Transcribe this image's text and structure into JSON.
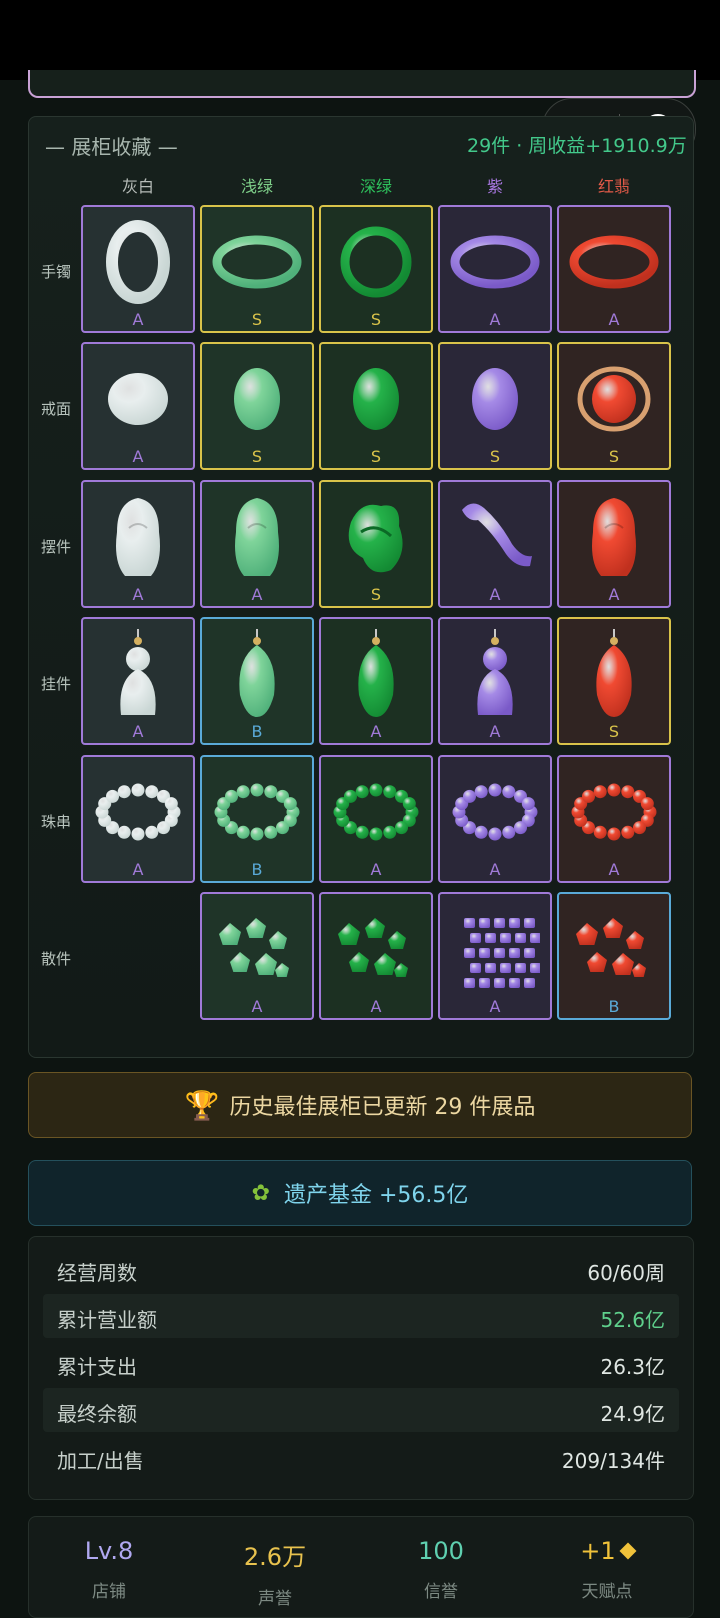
{
  "cabinet": {
    "title": "— 展柜收藏 —",
    "stats": "29件 · 周收益+1910.9万",
    "columns": [
      {
        "label": "灰白",
        "color": "#b6bcb8"
      },
      {
        "label": "浅绿",
        "color": "#7fd08a"
      },
      {
        "label": "深绿",
        "color": "#2ec25c"
      },
      {
        "label": "紫",
        "color": "#a877e0"
      },
      {
        "label": "红翡",
        "color": "#e05a48"
      }
    ],
    "rows": [
      {
        "label": "手镯",
        "cells": [
          "A",
          "S",
          "S",
          "A",
          "A"
        ]
      },
      {
        "label": "戒面",
        "cells": [
          "A",
          "S",
          "S",
          "S",
          "S"
        ]
      },
      {
        "label": "摆件",
        "cells": [
          "A",
          "A",
          "S",
          "A",
          "A"
        ]
      },
      {
        "label": "挂件",
        "cells": [
          "A",
          "B",
          "A",
          "A",
          "S"
        ]
      },
      {
        "label": "珠串",
        "cells": [
          "A",
          "B",
          "A",
          "A",
          "A"
        ]
      },
      {
        "label": "散件",
        "cells": [
          "",
          "A",
          "A",
          "A",
          "B"
        ]
      }
    ],
    "grade_colors": {
      "S": "#d9c34a",
      "A": "#a07ad8",
      "B": "#5aaad8"
    }
  },
  "best_banner": {
    "icon": "trophy-icon",
    "text": "历史最佳展柜已更新 29 件展品"
  },
  "fund_banner": {
    "icon": "toad-icon",
    "text": "遗产基金 +56.5亿"
  },
  "summary": [
    {
      "key": "经营周数",
      "value": "60/60周"
    },
    {
      "key": "累计营业额",
      "value": "52.6亿",
      "accent": "#5fd08c"
    },
    {
      "key": "累计支出",
      "value": "26.3亿"
    },
    {
      "key": "最终余额",
      "value": "24.9亿"
    },
    {
      "key": "加工/出售",
      "value": "209/134件"
    }
  ],
  "level_bar": [
    {
      "value": "Lv.8",
      "label": "店铺",
      "color": "#b0a8f0"
    },
    {
      "value": "2.6万",
      "label": "声誉",
      "color": "#e8c24e"
    },
    {
      "value": "100",
      "label": "信誉",
      "color": "#5fd0b0"
    },
    {
      "value": "+1",
      "label": "天赋点",
      "color": "#f0c23a",
      "icon": "diamond-icon"
    }
  ]
}
